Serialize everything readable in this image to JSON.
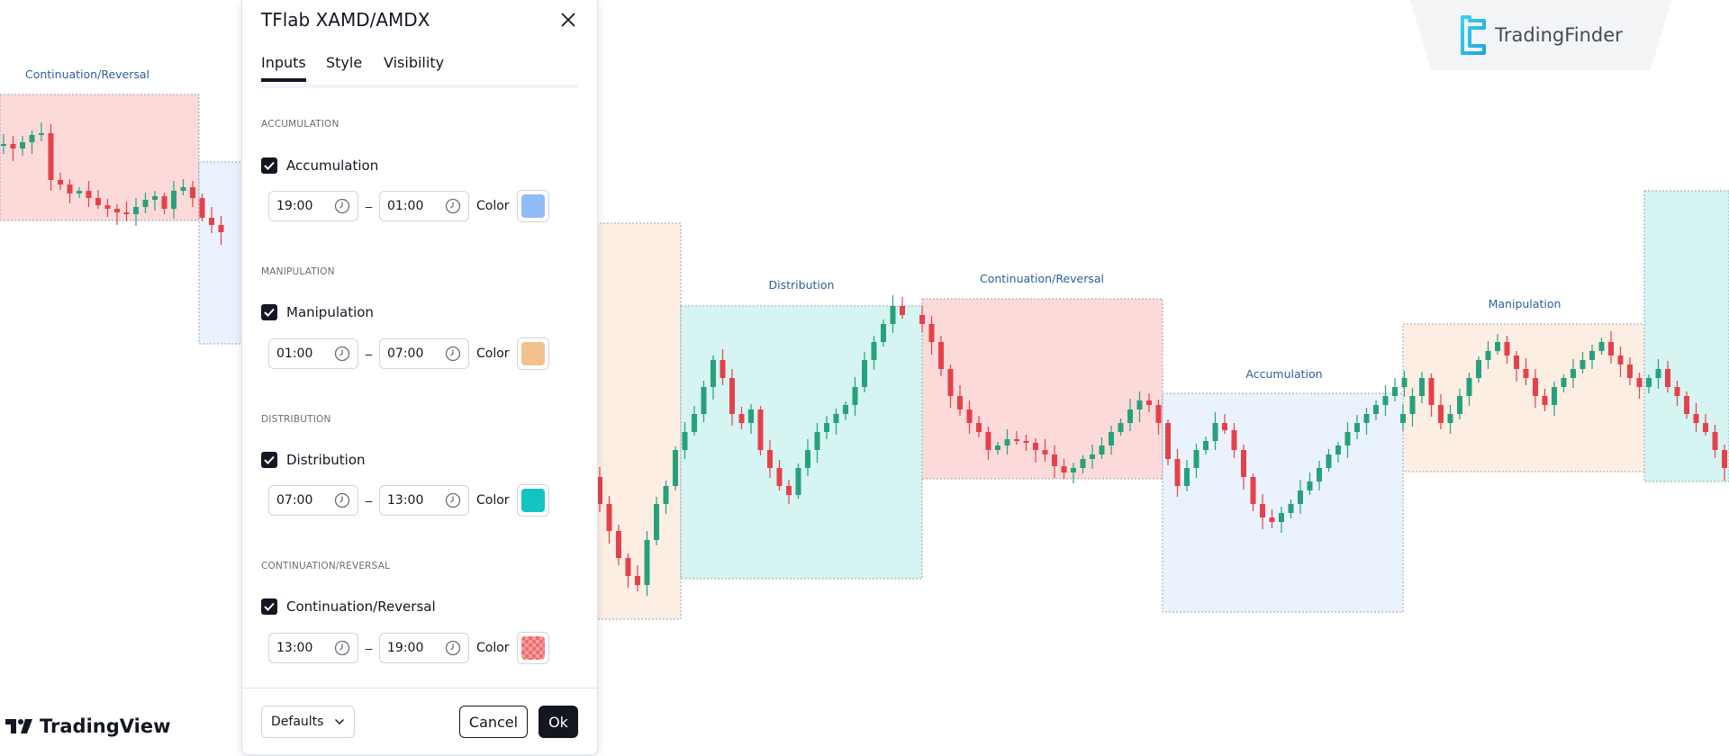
{
  "dialog": {
    "title": "TFlab XAMD/AMDX",
    "tabs": [
      "Inputs",
      "Style",
      "Visibility"
    ],
    "active_tab": "Inputs",
    "color_label": "Color",
    "sections": [
      {
        "heading": "ACCUMULATION",
        "checkbox_label": "Accumulation",
        "checked": true,
        "start": "19:00",
        "end": "01:00",
        "color": "#8fbcf8"
      },
      {
        "heading": "MANIPULATION",
        "checkbox_label": "Manipulation",
        "checked": true,
        "start": "01:00",
        "end": "07:00",
        "color": "#f3c18e"
      },
      {
        "heading": "DISTRIBUTION",
        "checkbox_label": "Distribution",
        "checked": true,
        "start": "07:00",
        "end": "13:00",
        "color": "#14c3c3"
      },
      {
        "heading": "CONTINUATION/REVERSAL",
        "checkbox_label": "Continuation/Reversal",
        "checked": true,
        "start": "13:00",
        "end": "19:00",
        "color": "#ef6b6b"
      }
    ],
    "footer": {
      "defaults_label": "Defaults",
      "cancel_label": "Cancel",
      "ok_label": "Ok"
    }
  },
  "zone_labels": {
    "z1": "Continuation/Reversal",
    "z2": "Distribution",
    "z3": "Continuation/Reversal",
    "z4": "Accumulation",
    "z5": "Manipulation"
  },
  "logos": {
    "tradingfinder": "TradingFinder",
    "tradingview": "TradingView"
  },
  "colors": {
    "bull": "#26a17b",
    "bear": "#e5414b",
    "accumulation_zone": "#e6f0fc",
    "manipulation_zone": "#fdeee2",
    "distribution_zone": "#d4f3f2",
    "reversal_zone": "#fcdada"
  }
}
